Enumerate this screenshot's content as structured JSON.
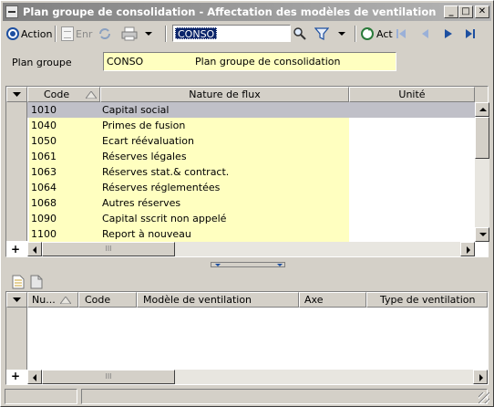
{
  "window": {
    "title": "Plan groupe de consolidation -  Affectation des modèles de ventilation",
    "minimize_glyph": "_",
    "maximize_glyph": "□",
    "close_glyph": "✕"
  },
  "toolbar": {
    "action_label": "Action",
    "save_label": "Enr",
    "combo_value": "CONSO",
    "act_label": "Act"
  },
  "form": {
    "plan_label": "Plan groupe",
    "plan_code": "CONSO",
    "plan_name": "Plan groupe de consolidation"
  },
  "grid1": {
    "columns": [
      "Code",
      "Nature de flux",
      "Unité"
    ],
    "rows": [
      {
        "code": "1010",
        "nature": "Capital social"
      },
      {
        "code": "1040",
        "nature": "Primes de fusion"
      },
      {
        "code": "1050",
        "nature": "Ecart réévaluation"
      },
      {
        "code": "1061",
        "nature": "Réserves légales"
      },
      {
        "code": "1063",
        "nature": "Réserves stat.& contract."
      },
      {
        "code": "1064",
        "nature": "Réserves réglementées"
      },
      {
        "code": "1068",
        "nature": "Autres réserves"
      },
      {
        "code": "1090",
        "nature": "Capital sscrit non appelé"
      },
      {
        "code": "1100",
        "nature": "Report à nouveau"
      }
    ],
    "plus": "+",
    "grip_marks": "III"
  },
  "grid2": {
    "columns": [
      "Nu...",
      "Code",
      "Modèle de ventilation",
      "Axe",
      "Type de ventilation"
    ],
    "plus": "+",
    "grip_marks": "III"
  },
  "colors": {
    "highlight": "#ffffc0",
    "selection": "#0a246a",
    "accent": "#1d4fa0"
  }
}
